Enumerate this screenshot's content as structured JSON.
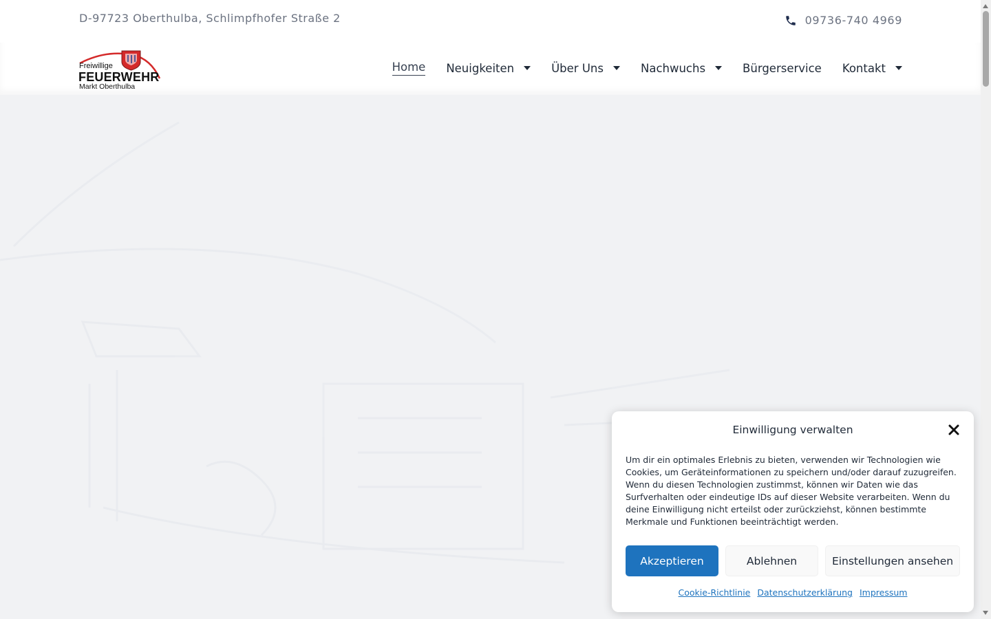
{
  "topbar": {
    "address": "D-97723 Oberthulba, Schlimpfhofer Straße 2",
    "phone": "09736-740 4969"
  },
  "logo": {
    "line1": "Freiwillige",
    "line2": "FEUERWEHR",
    "line3": "Markt Oberthulba"
  },
  "nav": {
    "items": [
      {
        "label": "Home",
        "active": true,
        "dropdown": false
      },
      {
        "label": "Neuigkeiten",
        "active": false,
        "dropdown": true
      },
      {
        "label": "Über Uns",
        "active": false,
        "dropdown": true
      },
      {
        "label": "Nachwuchs",
        "active": false,
        "dropdown": true
      },
      {
        "label": "Bürgerservice",
        "active": false,
        "dropdown": false
      },
      {
        "label": "Kontakt",
        "active": false,
        "dropdown": true
      }
    ]
  },
  "consent": {
    "title": "Einwilligung verwalten",
    "text": "Um dir ein optimales Erlebnis zu bieten, verwenden wir Technologien wie Cookies, um Geräteinformationen zu speichern und/oder darauf zuzugreifen. Wenn du diesen Technologien zustimmst, können wir Daten wie das Surfverhalten oder eindeutige IDs auf dieser Website verarbeiten. Wenn du deine Einwilligung nicht erteilst oder zurückziehst, können bestimmte Merkmale und Funktionen beeinträchtigt werden.",
    "accept_label": "Akzeptieren",
    "deny_label": "Ablehnen",
    "settings_label": "Einstellungen ansehen",
    "links": [
      "Cookie-Richtlinie",
      "Datenschutzerklärung",
      "Impressum"
    ]
  },
  "colors": {
    "accent": "#1e73be",
    "hero_bg": "#f1f2f4",
    "logo_red": "#d42a2a"
  },
  "icons": {
    "phone": "phone-icon",
    "close": "close-icon",
    "caret": "caret-down-icon"
  }
}
